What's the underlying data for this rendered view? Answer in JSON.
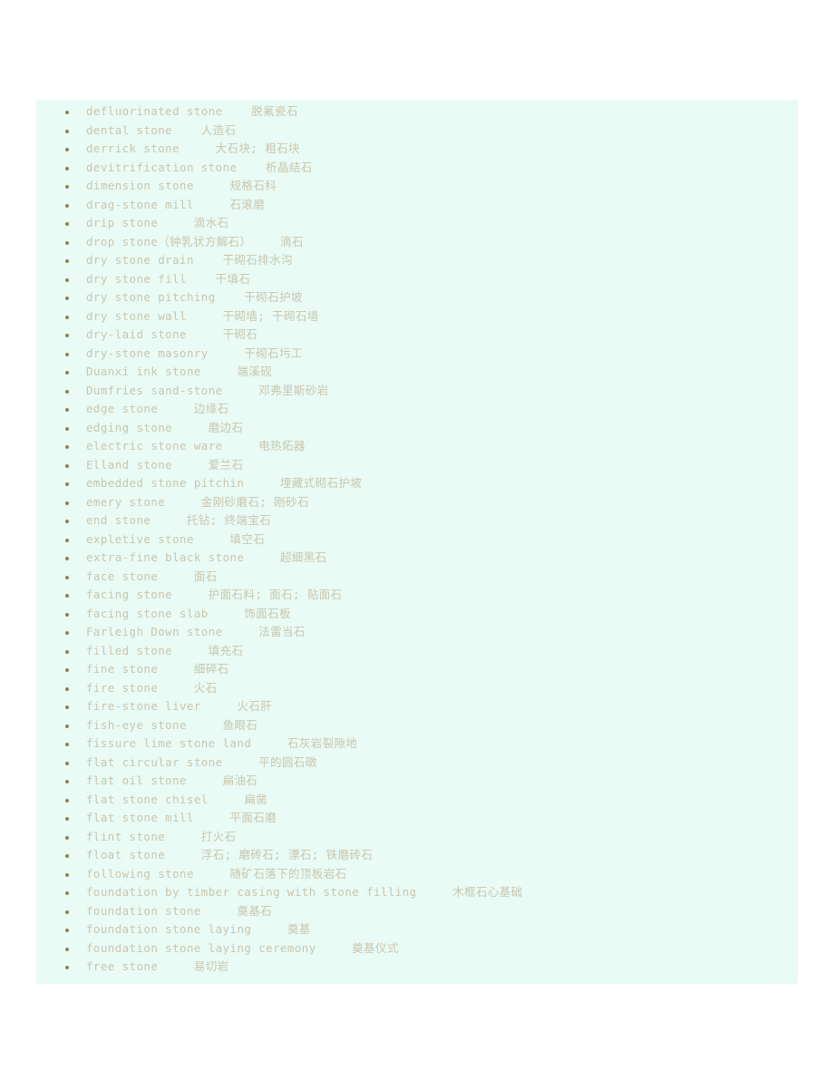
{
  "page": {
    "background_color": "#ffffff",
    "content_background_color": "#e8fbf5",
    "text_color": "#c9c6ae",
    "bullet_color": "#8a8455"
  },
  "glossary": {
    "entries": [
      {
        "term": "defluorinated stone",
        "translation": "脱氟瓷石",
        "line": "defluorinated stone    脱氟瓷石"
      },
      {
        "term": "dental stone",
        "translation": "人造石",
        "line": "dental stone    人造石"
      },
      {
        "term": "derrick stone",
        "translation": "大石块; 粗石块",
        "line": "derrick stone     大石块; 粗石块"
      },
      {
        "term": "devitrification stone",
        "translation": "析晶结石",
        "line": "devitrification stone    析晶结石"
      },
      {
        "term": "dimension stone",
        "translation": "规格石科",
        "line": "dimension stone     规格石科"
      },
      {
        "term": "drag-stone mill",
        "translation": "石滚磨",
        "line": "drag-stone mill     石滚磨"
      },
      {
        "term": "drip stone",
        "translation": "滴水石",
        "line": "drip stone     滴水石"
      },
      {
        "term": "drop stone（钟乳状方解石）",
        "translation": "滴石",
        "line": "drop stone（钟乳状方解石）    滴石"
      },
      {
        "term": "dry stone drain",
        "translation": "干砌石排水沟",
        "line": "dry stone drain    干砌石排水沟"
      },
      {
        "term": "dry stone fill",
        "translation": "干填石",
        "line": "dry stone fill    干填石"
      },
      {
        "term": "dry stone pitching",
        "translation": "干砌石护坡",
        "line": "dry stone pitching    干砌石护坡"
      },
      {
        "term": "dry stone wall",
        "translation": "干砌墙; 干砌石墙",
        "line": "dry stone wall     干砌墙; 干砌石墙"
      },
      {
        "term": "dry-laid stone",
        "translation": "干砌石",
        "line": "dry-laid stone     干砌石"
      },
      {
        "term": "dry-stone masonry",
        "translation": "干砌石圬工",
        "line": "dry-stone masonry     干砌石圬工"
      },
      {
        "term": "Duanxi ink stone",
        "translation": "端溪砚",
        "line": "Duanxi ink stone     端溪砚"
      },
      {
        "term": "Dumfries sand-stone",
        "translation": "邓弗里斯砂岩",
        "line": "Dumfries sand-stone     邓弗里斯砂岩"
      },
      {
        "term": "edge stone",
        "translation": "边缘石",
        "line": "edge stone     边缘石"
      },
      {
        "term": "edging stone",
        "translation": "磨边石",
        "line": "edging stone     磨边石"
      },
      {
        "term": "electric stone ware",
        "translation": "电热炻器",
        "line": "electric stone ware     电热炻器"
      },
      {
        "term": "Elland stone",
        "translation": "爱兰石",
        "line": "Elland stone     爱兰石"
      },
      {
        "term": "embedded stone pitchin",
        "translation": "埋藏式砌石护坡",
        "line": "embedded stone pitchin     埋藏式砌石护坡"
      },
      {
        "term": "emery stone",
        "translation": "金刚砂磨石; 刚砂石",
        "line": "emery stone     金刚砂磨石; 刚砂石"
      },
      {
        "term": "end stone",
        "translation": "托钻; 终端宝石",
        "line": "end stone     托钻; 终端宝石"
      },
      {
        "term": "expletive stone",
        "translation": "填空石",
        "line": "expletive stone     填空石"
      },
      {
        "term": "extra-fine black stone",
        "translation": "超细黑石",
        "line": "extra-fine black stone     超细黑石"
      },
      {
        "term": "face stone",
        "translation": "面石",
        "line": "face stone     面石"
      },
      {
        "term": "facing stone",
        "translation": "护面石料; 面石; 贴面石",
        "line": "facing stone     护面石料; 面石; 贴面石"
      },
      {
        "term": "facing stone slab",
        "translation": "饰面石板",
        "line": "facing stone slab     饰面石板"
      },
      {
        "term": "Farleigh Down stone",
        "translation": "法雷当石",
        "line": "Farleigh Down stone     法雷当石"
      },
      {
        "term": "filled stone",
        "translation": "填充石",
        "line": "filled stone     填充石"
      },
      {
        "term": "fine stone",
        "translation": "细碎石",
        "line": "fine stone     细碎石"
      },
      {
        "term": "fire stone",
        "translation": "火石",
        "line": "fire stone     火石"
      },
      {
        "term": "fire-stone liver",
        "translation": "火石肝",
        "line": "fire-stone liver     火石肝"
      },
      {
        "term": "fish-eye stone",
        "translation": "鱼眼石",
        "line": "fish-eye stone     鱼眼石"
      },
      {
        "term": "fissure lime stone land",
        "translation": "石灰岩裂隙地",
        "line": "fissure lime stone land     石灰岩裂隙地"
      },
      {
        "term": "flat circular stone",
        "translation": "平的圆石礅",
        "line": "flat circular stone     平的圆石礅"
      },
      {
        "term": "flat oil stone",
        "translation": "扁油石",
        "line": "flat oil stone     扁油石"
      },
      {
        "term": "flat stone chisel",
        "translation": "扁凿",
        "line": "flat stone chisel     扁凿"
      },
      {
        "term": "flat stone mill",
        "translation": "平面石磨",
        "line": "flat stone mill     平面石磨"
      },
      {
        "term": "flint stone",
        "translation": "打火石",
        "line": "flint stone     打火石"
      },
      {
        "term": "float stone",
        "translation": "浮石; 磨砖石; 漂石; 铁磨砖石",
        "line": "float stone     浮石; 磨砖石; 漂石; 铁磨砖石"
      },
      {
        "term": "following stone",
        "translation": "随矿石落下的顶板岩石",
        "line": "following stone     随矿石落下的顶板岩石"
      },
      {
        "term": "foundation by timber casing with stone filling",
        "translation": "木框石心基础",
        "line": "foundation by timber casing with stone filling     木框石心基础"
      },
      {
        "term": "foundation stone",
        "translation": "奠基石",
        "line": "foundation stone     奠基石"
      },
      {
        "term": "foundation stone laying",
        "translation": "奠基",
        "line": "foundation stone laying     奠基"
      },
      {
        "term": "foundation stone laying ceremony",
        "translation": "奠基仪式",
        "line": "foundation stone laying ceremony     奠基仪式"
      },
      {
        "term": "free stone",
        "translation": "易切岩",
        "line": "free stone     易切岩"
      }
    ]
  }
}
